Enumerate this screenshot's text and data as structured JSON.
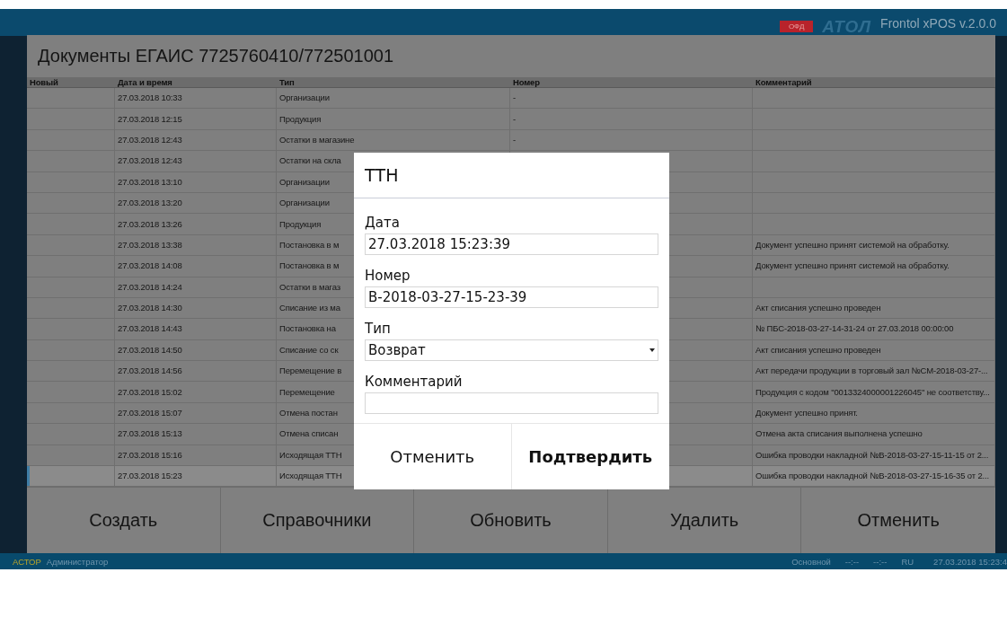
{
  "topbar": {
    "badge": "ОФД",
    "logo": "АТОЛ",
    "product": "Frontol xPOS v.2.0.0"
  },
  "title": "Документы ЕГАИС 7725760410/772501001",
  "table": {
    "columns": [
      "Новый",
      "Дата и время",
      "Тип",
      "Номер",
      "Комментарий"
    ],
    "rows": [
      {
        "date": "27.03.2018 10:33",
        "type": "Организации",
        "number": "-",
        "selected": false
      },
      {
        "date": "27.03.2018 12:15",
        "type": "Продукция",
        "number": "-",
        "selected": false
      },
      {
        "date": "27.03.2018 12:43",
        "type": "Остатки в магазине",
        "number": "-",
        "selected": false
      },
      {
        "date": "27.03.2018 12:43",
        "type": "Остатки на скла",
        "selected": false
      },
      {
        "date": "27.03.2018 13:10",
        "type": "Организации",
        "selected": false
      },
      {
        "date": "27.03.2018 13:20",
        "type": "Организации",
        "selected": false
      },
      {
        "date": "27.03.2018 13:26",
        "type": "Продукция",
        "selected": false
      },
      {
        "date": "27.03.2018 13:38",
        "type": "Постановка в м",
        "comment": "Документ успешно принят системой на обработку.",
        "selected": false
      },
      {
        "date": "27.03.2018 14:08",
        "type": "Постановка в м",
        "comment": "Документ успешно принят системой на обработку.",
        "selected": false
      },
      {
        "date": "27.03.2018 14:24",
        "type": "Остатки в магаз",
        "selected": false
      },
      {
        "date": "27.03.2018 14:30",
        "type": "Списание из ма",
        "comment": "Акт списания успешно проведен",
        "selected": false
      },
      {
        "date": "27.03.2018 14:43",
        "type": "Постановка на",
        "comment": "№ ПБС-2018-03-27-14-31-24 от 27.03.2018 00:00:00",
        "selected": false
      },
      {
        "date": "27.03.2018 14:50",
        "type": "Списание со ск",
        "comment": "Акт списания успешно проведен",
        "selected": false
      },
      {
        "date": "27.03.2018 14:56",
        "type": "Перемещение в",
        "comment": "Акт передачи продукции в торговый зал №СМ-2018-03-27-...",
        "selected": false
      },
      {
        "date": "27.03.2018 15:02",
        "type": "Перемещение",
        "comment": " Продукция с кодом \"0013324000001226045\" не соответству...",
        "selected": false
      },
      {
        "date": "27.03.2018 15:07",
        "type": "Отмена постан",
        "comment": "Документ успешно принят.",
        "selected": false
      },
      {
        "date": "27.03.2018 15:13",
        "type": "Отмена списан",
        "comment": "Отмена акта списания выполнена успешно",
        "selected": false
      },
      {
        "date": "27.03.2018 15:16",
        "type": "Исходящая ТТН",
        "comment": "Ошибка проводки накладной №В-2018-03-27-15-11-15 от 2...",
        "selected": false
      },
      {
        "date": "27.03.2018 15:23",
        "type": "Исходящая ТТН",
        "comment": "Ошибка проводки накладной №В-2018-03-27-15-16-35 от 2...",
        "selected": true
      }
    ]
  },
  "buttons": [
    "Создать",
    "Справочники",
    "Обновить",
    "Удалить",
    "Отменить"
  ],
  "dialog": {
    "title": "ТТН",
    "fields": [
      {
        "label": "Дата",
        "kind": "text",
        "value": "27.03.2018 15:23:39"
      },
      {
        "label": "Номер",
        "kind": "text",
        "value": "В-2018-03-27-15-23-39"
      },
      {
        "label": "Тип",
        "kind": "select",
        "value": "Возврат"
      },
      {
        "label": "Комментарий",
        "kind": "text"
      }
    ],
    "buttons": [
      {
        "label": "Отменить",
        "primary": false
      },
      {
        "label": "Подтвердить",
        "primary": true
      }
    ]
  },
  "status_bar": {
    "company": "АСТОР",
    "user": "Администратор",
    "mode": "Основной",
    "time_1": "--:--",
    "time_2": "--:--",
    "language": "RU",
    "datetime": "27.03.2018 15:23:4"
  }
}
